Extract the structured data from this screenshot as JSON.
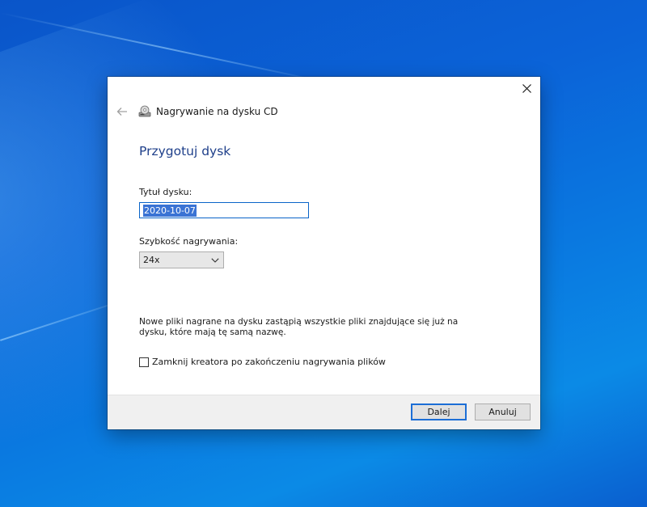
{
  "dialog": {
    "title": "Nagrywanie na dysku CD",
    "heading": "Przygotuj dysk",
    "disc_title_label": "Tytuł dysku:",
    "disc_title_value": "2020-10-07",
    "speed_label": "Szybkość nagrywania:",
    "speed_value": "24x",
    "info_text": "Nowe pliki nagrane na dysku zastąpią wszystkie pliki znajdujące się już na dysku, które mają tę samą nazwę.",
    "close_wizard_label": "Zamknij kreatora po zakończeniu nagrywania plików",
    "close_wizard_checked": false,
    "next_button": "Dalej",
    "cancel_button": "Anuluj"
  },
  "colors": {
    "heading": "#1e3f8a",
    "accent": "#1c6ed6",
    "selection": "#3a73d4"
  },
  "icons": {
    "back": "arrow-left-icon",
    "title": "cd-burner-icon",
    "close": "close-icon",
    "dropdown": "chevron-down-icon"
  }
}
